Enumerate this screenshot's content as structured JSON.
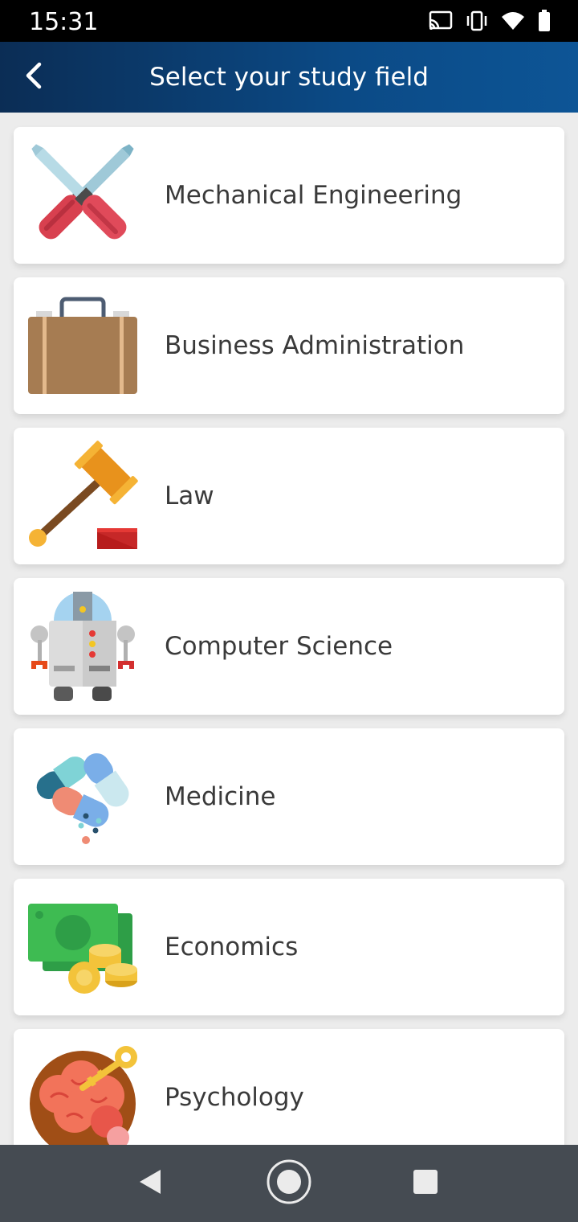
{
  "status_bar": {
    "time": "15:31",
    "icons": [
      "cast-icon",
      "vibrate-icon",
      "wifi-icon",
      "battery-icon"
    ]
  },
  "header": {
    "title": "Select your study field",
    "back_icon": "back-arrow-icon"
  },
  "fields": [
    {
      "label": "Mechanical Engineering",
      "icon": "crossed-screwdrivers-icon"
    },
    {
      "label": "Business Administration",
      "icon": "briefcase-icon"
    },
    {
      "label": "Law",
      "icon": "gavel-icon"
    },
    {
      "label": "Computer Science",
      "icon": "robot-icon"
    },
    {
      "label": "Medicine",
      "icon": "pills-icon"
    },
    {
      "label": "Economics",
      "icon": "money-coins-icon"
    },
    {
      "label": "Psychology",
      "icon": "brain-key-icon"
    }
  ],
  "colors": {
    "app_bar_start": "#0b2d55",
    "app_bar_end": "#0d5596",
    "list_background": "#ececec",
    "nav_bar": "#454b52"
  },
  "nav_bar": {
    "buttons": [
      "nav-back-icon",
      "nav-home-icon",
      "nav-recents-icon"
    ]
  }
}
